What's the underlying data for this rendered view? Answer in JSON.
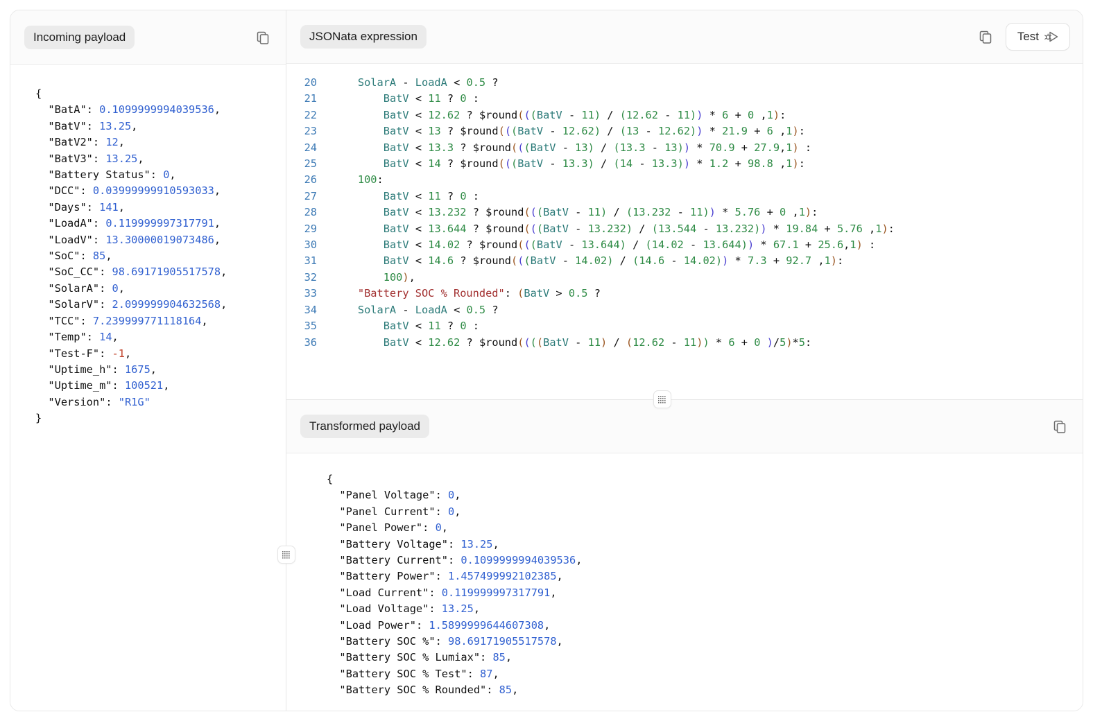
{
  "panels": {
    "incoming": {
      "title": "Incoming payload",
      "copy_icon": "copy-icon",
      "lines": [
        {
          "indent": 0,
          "text": "{",
          "type": "punct"
        },
        {
          "indent": 1,
          "key": "\"BatA\"",
          "value": "0.1099999994039536",
          "vtype": "num",
          "comma": true
        },
        {
          "indent": 1,
          "key": "\"BatV\"",
          "value": "13.25",
          "vtype": "num",
          "comma": true
        },
        {
          "indent": 1,
          "key": "\"BatV2\"",
          "value": "12",
          "vtype": "num",
          "comma": true
        },
        {
          "indent": 1,
          "key": "\"BatV3\"",
          "value": "13.25",
          "vtype": "num",
          "comma": true
        },
        {
          "indent": 1,
          "key": "\"Battery Status\"",
          "value": "0",
          "vtype": "num",
          "comma": true
        },
        {
          "indent": 1,
          "key": "\"DCC\"",
          "value": "0.03999999910593033",
          "vtype": "num",
          "comma": true
        },
        {
          "indent": 1,
          "key": "\"Days\"",
          "value": "141",
          "vtype": "num",
          "comma": true
        },
        {
          "indent": 1,
          "key": "\"LoadA\"",
          "value": "0.119999997317791",
          "vtype": "num",
          "comma": true
        },
        {
          "indent": 1,
          "key": "\"LoadV\"",
          "value": "13.30000019073486",
          "vtype": "num",
          "comma": true
        },
        {
          "indent": 1,
          "key": "\"SoC\"",
          "value": "85",
          "vtype": "num",
          "comma": true
        },
        {
          "indent": 1,
          "key": "\"SoC_CC\"",
          "value": "98.69171905517578",
          "vtype": "num",
          "comma": true
        },
        {
          "indent": 1,
          "key": "\"SolarA\"",
          "value": "0",
          "vtype": "num",
          "comma": true
        },
        {
          "indent": 1,
          "key": "\"SolarV\"",
          "value": "2.099999904632568",
          "vtype": "num",
          "comma": true
        },
        {
          "indent": 1,
          "key": "\"TCC\"",
          "value": "7.239999771118164",
          "vtype": "num",
          "comma": true
        },
        {
          "indent": 1,
          "key": "\"Temp\"",
          "value": "14",
          "vtype": "num",
          "comma": true
        },
        {
          "indent": 1,
          "key": "\"Test-F\"",
          "value": "-1",
          "vtype": "neg",
          "comma": true
        },
        {
          "indent": 1,
          "key": "\"Uptime_h\"",
          "value": "1675",
          "vtype": "num",
          "comma": true
        },
        {
          "indent": 1,
          "key": "\"Uptime_m\"",
          "value": "100521",
          "vtype": "num",
          "comma": true
        },
        {
          "indent": 1,
          "key": "\"Version\"",
          "value": "\"R1G\"",
          "vtype": "str",
          "comma": false
        },
        {
          "indent": 0,
          "text": "}",
          "type": "punct"
        }
      ]
    },
    "expression": {
      "title": "JSONata expression",
      "copy_icon": "copy-icon",
      "test_button": {
        "label": "Test",
        "icon": "debug-run-icon"
      },
      "first_line_number": 20,
      "lines": [
        {
          "num": "20",
          "code": "    SolarA - LoadA < 0.5 ?"
        },
        {
          "num": "21",
          "code": "        BatV < 11 ? 0 :"
        },
        {
          "num": "22",
          "code": "        BatV < 12.62 ? $round(((BatV - 11) / (12.62 - 11)) * 6 + 0 ,1):"
        },
        {
          "num": "23",
          "code": "        BatV < 13 ? $round(((BatV - 12.62) / (13 - 12.62)) * 21.9 + 6 ,1):"
        },
        {
          "num": "24",
          "code": "        BatV < 13.3 ? $round(((BatV - 13) / (13.3 - 13)) * 70.9 + 27.9,1) :"
        },
        {
          "num": "25",
          "code": "        BatV < 14 ? $round(((BatV - 13.3) / (14 - 13.3)) * 1.2 + 98.8 ,1):"
        },
        {
          "num": "26",
          "code": "    100:"
        },
        {
          "num": "27",
          "code": "        BatV < 11 ? 0 :"
        },
        {
          "num": "28",
          "code": "        BatV < 13.232 ? $round(((BatV - 11) / (13.232 - 11)) * 5.76 + 0 ,1):"
        },
        {
          "num": "29",
          "code": "        BatV < 13.644 ? $round(((BatV - 13.232) / (13.544 - 13.232)) * 19.84 + 5.76 ,1):"
        },
        {
          "num": "30",
          "code": "        BatV < 14.02 ? $round(((BatV - 13.644) / (14.02 - 13.644)) * 67.1 + 25.6,1) :"
        },
        {
          "num": "31",
          "code": "        BatV < 14.6 ? $round(((BatV - 14.02) / (14.6 - 14.02)) * 7.3 + 92.7 ,1):"
        },
        {
          "num": "32",
          "code": "        100),"
        },
        {
          "num": "33",
          "code": "    \"Battery SOC % Rounded\": (BatV > 0.5 ?"
        },
        {
          "num": "34",
          "code": "    SolarA - LoadA < 0.5 ?"
        },
        {
          "num": "35",
          "code": "        BatV < 11 ? 0 :"
        },
        {
          "num": "36",
          "code": "        BatV < 12.62 ? $round((((BatV - 11) / (12.62 - 11)) * 6 + 0 )/5)*5:"
        }
      ]
    },
    "transformed": {
      "title": "Transformed payload",
      "copy_icon": "copy-icon",
      "lines": [
        {
          "indent": 0,
          "text": "{",
          "type": "punct"
        },
        {
          "indent": 1,
          "key": "\"Panel Voltage\"",
          "value": "0",
          "vtype": "num",
          "comma": true
        },
        {
          "indent": 1,
          "key": "\"Panel Current\"",
          "value": "0",
          "vtype": "num",
          "comma": true
        },
        {
          "indent": 1,
          "key": "\"Panel Power\"",
          "value": "0",
          "vtype": "num",
          "comma": true
        },
        {
          "indent": 1,
          "key": "\"Battery Voltage\"",
          "value": "13.25",
          "vtype": "num",
          "comma": true
        },
        {
          "indent": 1,
          "key": "\"Battery Current\"",
          "value": "0.1099999994039536",
          "vtype": "num",
          "comma": true
        },
        {
          "indent": 1,
          "key": "\"Battery Power\"",
          "value": "1.457499992102385",
          "vtype": "num",
          "comma": true
        },
        {
          "indent": 1,
          "key": "\"Load Current\"",
          "value": "0.119999997317791",
          "vtype": "num",
          "comma": true
        },
        {
          "indent": 1,
          "key": "\"Load Voltage\"",
          "value": "13.25",
          "vtype": "num",
          "comma": true
        },
        {
          "indent": 1,
          "key": "\"Load Power\"",
          "value": "1.5899999644607308",
          "vtype": "num",
          "comma": true
        },
        {
          "indent": 1,
          "key": "\"Battery SOC %\"",
          "value": "98.69171905517578",
          "vtype": "num",
          "comma": true
        },
        {
          "indent": 1,
          "key": "\"Battery SOC % Lumiax\"",
          "value": "85",
          "vtype": "num",
          "comma": true
        },
        {
          "indent": 1,
          "key": "\"Battery SOC % Test\"",
          "value": "87",
          "vtype": "num",
          "comma": true
        },
        {
          "indent": 1,
          "key": "\"Battery SOC % Rounded\"",
          "value": "85",
          "vtype": "num",
          "comma": true
        }
      ]
    }
  },
  "handles": {
    "vertical_splitter": "drag-handle",
    "horizontal_splitter": "drag-handle"
  },
  "colors": {
    "identifier": "#2b7a78",
    "number_json": "#2f5fd0",
    "number_code": "#2e8b45",
    "string_red": "#a23030",
    "negative": "#c1432b",
    "line_number": "#3d7ab5",
    "chip_bg": "#ebebeb"
  }
}
